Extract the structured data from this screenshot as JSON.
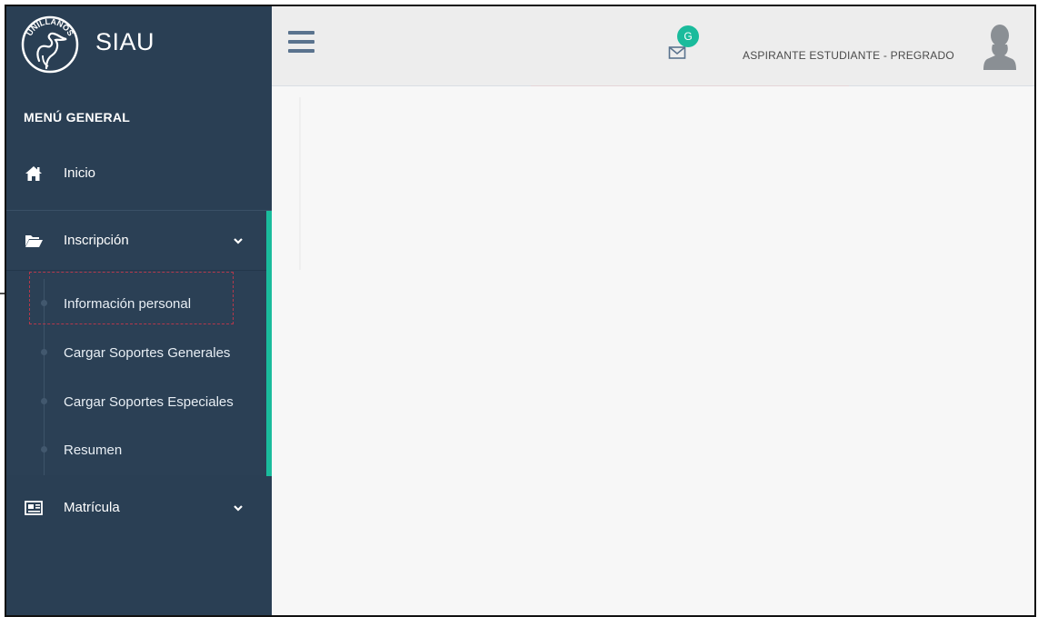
{
  "brand": {
    "title": "SIAU",
    "logo_text": "UNILLANOS",
    "logo_icon": "heron-logo-icon"
  },
  "sidebar": {
    "menu_title": "MENÚ GENERAL",
    "items": [
      {
        "label": "Inicio",
        "icon": "home-icon"
      },
      {
        "label": "Inscripción",
        "icon": "folder-open-icon",
        "expanded": true,
        "children": [
          {
            "label": "Información personal",
            "active": true
          },
          {
            "label": "Cargar Soportes Generales"
          },
          {
            "label": "Cargar Soportes Especiales"
          },
          {
            "label": "Resumen"
          }
        ]
      },
      {
        "label": "Matrícula",
        "icon": "id-card-icon",
        "expanded": false
      }
    ]
  },
  "topbar": {
    "menu_toggle_icon": "hamburger-icon",
    "notifications": {
      "icon": "envelope-icon",
      "badge": "G"
    },
    "user_role": "ASPIRANTE ESTUDIANTE - PREGRADO",
    "avatar_icon": "user-silhouette-icon"
  },
  "colors": {
    "sidebar_bg": "#2a3f54",
    "accent": "#1abb9c",
    "topbar_bg": "#ededed",
    "content_bg": "#f7f7f7",
    "highlight_border": "#b5384b"
  }
}
